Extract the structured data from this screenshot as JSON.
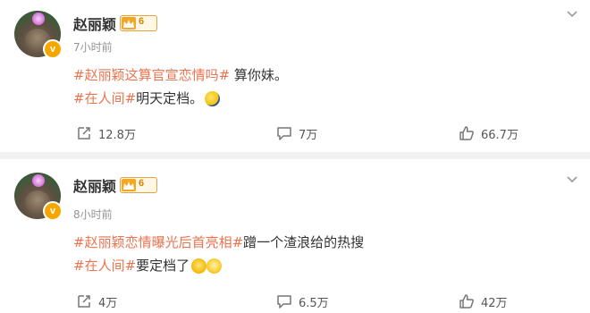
{
  "posts": [
    {
      "author": "赵丽颖",
      "level": "6",
      "time": "7小时前",
      "line1_tag": "#赵丽颖这算官宣恋情吗#",
      "line1_text": " 算你妹。",
      "line2_tag": "#在人间#",
      "line2_text": "明天定档。",
      "repost": "12.8万",
      "comment": "7万",
      "like": "66.7万"
    },
    {
      "author": "赵丽颖",
      "level": "6",
      "time": "8小时前",
      "line1_tag": "#赵丽颖恋情曝光后首亮相#",
      "line1_text": "蹭一个渣浪给的热搜",
      "line2_tag": "#在人间#",
      "line2_text": "要定档了",
      "repost": "4万",
      "comment": "6.5万",
      "like": "42万"
    }
  ],
  "icons": {
    "verified": "v-badge-icon",
    "member_crown": "crown-icon",
    "more": "chevron-down-icon",
    "repost": "repost-icon",
    "comment": "comment-icon",
    "like": "thumbs-up-icon"
  },
  "colors": {
    "tag": "#eb7350",
    "verified_badge": "#f7a600"
  }
}
